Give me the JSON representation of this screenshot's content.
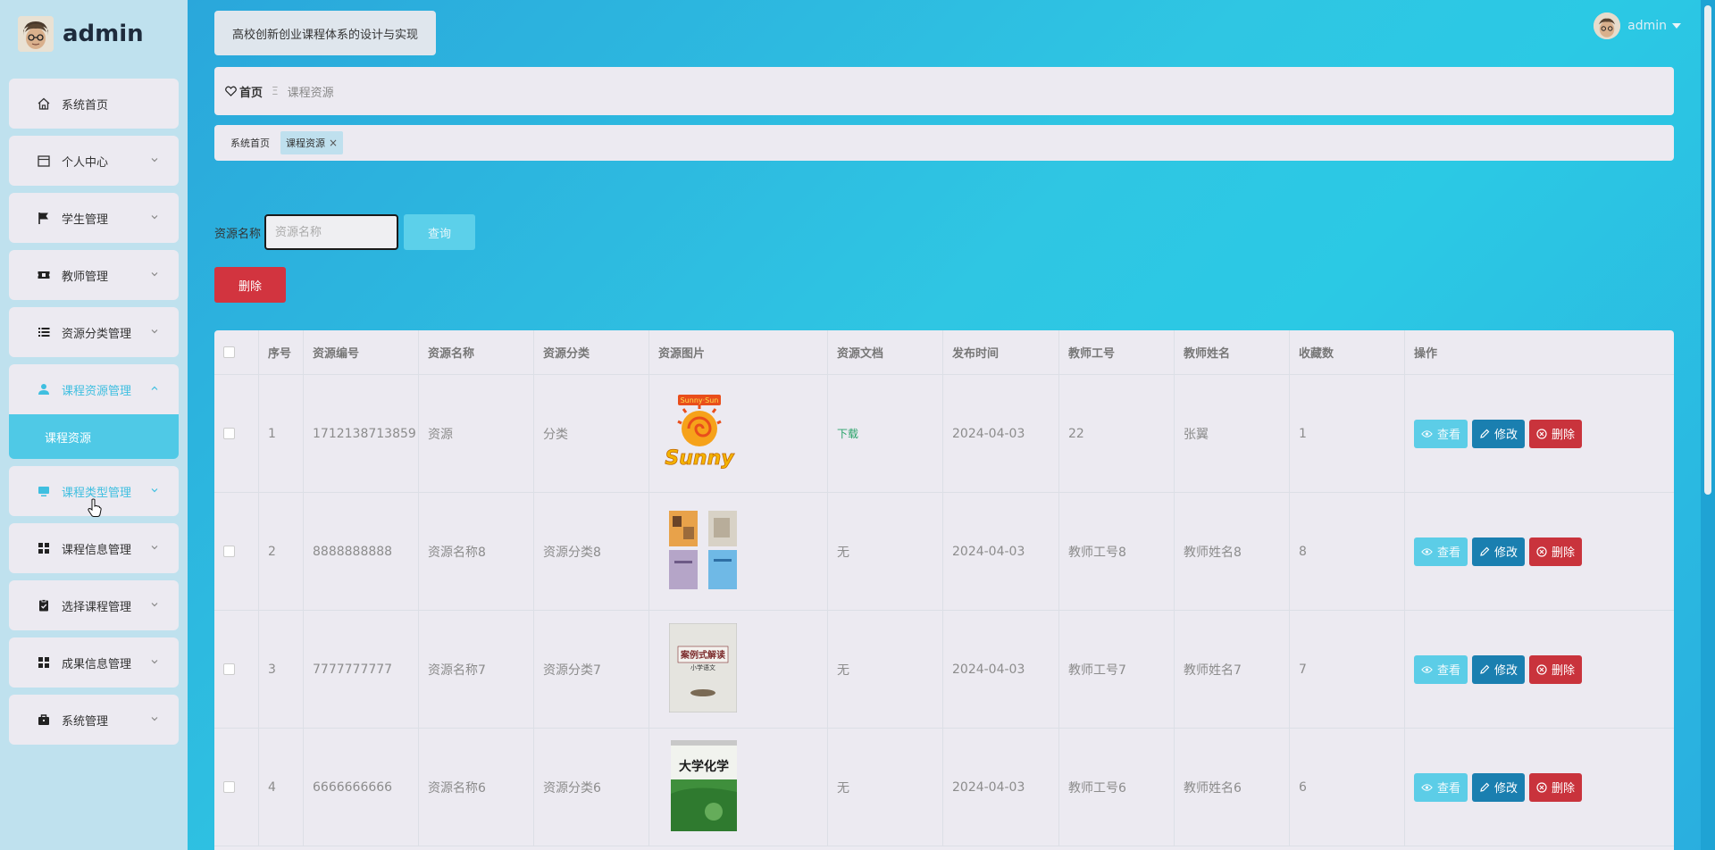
{
  "sidebar": {
    "brand": "admin",
    "menu": [
      {
        "label": "系统首页",
        "icon": "home-icon"
      },
      {
        "label": "个人中心",
        "icon": "calendar-icon"
      },
      {
        "label": "学生管理",
        "icon": "flag-icon"
      },
      {
        "label": "教师管理",
        "icon": "ticket-icon"
      },
      {
        "label": "资源分类管理",
        "icon": "list-icon"
      },
      {
        "label": "课程资源管理",
        "icon": "user-stamp-icon"
      },
      {
        "label": "课程类型管理",
        "icon": "monitor-icon"
      },
      {
        "label": "课程信息管理",
        "icon": "grid-icon"
      },
      {
        "label": "选择课程管理",
        "icon": "clipboard-icon"
      },
      {
        "label": "成果信息管理",
        "icon": "grid-icon"
      },
      {
        "label": "系统管理",
        "icon": "briefcase-icon"
      }
    ],
    "submenu_active": "课程资源"
  },
  "header": {
    "site_title": "高校创新创业课程体系的设计与实现",
    "user_name": "admin"
  },
  "breadcrumb": {
    "home": "首页",
    "separator": "Ξ",
    "current": "课程资源"
  },
  "tags": [
    {
      "label": "系统首页"
    },
    {
      "label": "课程资源",
      "close": "×"
    }
  ],
  "search": {
    "label": "资源名称",
    "placeholder": "资源名称",
    "query_button": "查询"
  },
  "toolbar": {
    "delete_button": "删除"
  },
  "table": {
    "columns": [
      "序号",
      "资源编号",
      "资源名称",
      "资源分类",
      "资源图片",
      "资源文档",
      "发布时间",
      "教师工号",
      "教师姓名",
      "收藏数",
      "操作"
    ],
    "rows": [
      {
        "index": "1",
        "code": "1712138713859",
        "name": "资源",
        "category": "分类",
        "image": "sunny-logo",
        "doc": "下载",
        "time": "2024-04-03",
        "teacher_no": "22",
        "teacher_name": "张翼",
        "favorites": "1"
      },
      {
        "index": "2",
        "code": "8888888888",
        "name": "资源名称8",
        "category": "资源分类8",
        "image": "book-collage",
        "doc": "无",
        "time": "2024-04-03",
        "teacher_no": "教师工号8",
        "teacher_name": "教师姓名8",
        "favorites": "8"
      },
      {
        "index": "3",
        "code": "7777777777",
        "name": "资源名称7",
        "category": "资源分类7",
        "image": "book-cover-grey",
        "doc": "无",
        "time": "2024-04-03",
        "teacher_no": "教师工号7",
        "teacher_name": "教师姓名7",
        "favorites": "7"
      },
      {
        "index": "4",
        "code": "6666666666",
        "name": "资源名称6",
        "category": "资源分类6",
        "image": "book-cover-chemistry",
        "doc": "无",
        "time": "2024-04-03",
        "teacher_no": "教师工号6",
        "teacher_name": "教师姓名6",
        "favorites": "6"
      }
    ],
    "actions": {
      "view": "查看",
      "edit": "修改",
      "delete": "删除"
    }
  },
  "thumb_text": {
    "sunny": "Sunny",
    "sunny_top": "Sunny·Sun",
    "book3_title": "案例式解读",
    "book3_sub": "小学语文",
    "book4_title": "大学化学"
  },
  "colors": {
    "accent": "#3fbfe0",
    "danger": "#d2343f",
    "edit": "#1a7fb0",
    "view": "#5ccde7",
    "download": "#2aa36a"
  }
}
